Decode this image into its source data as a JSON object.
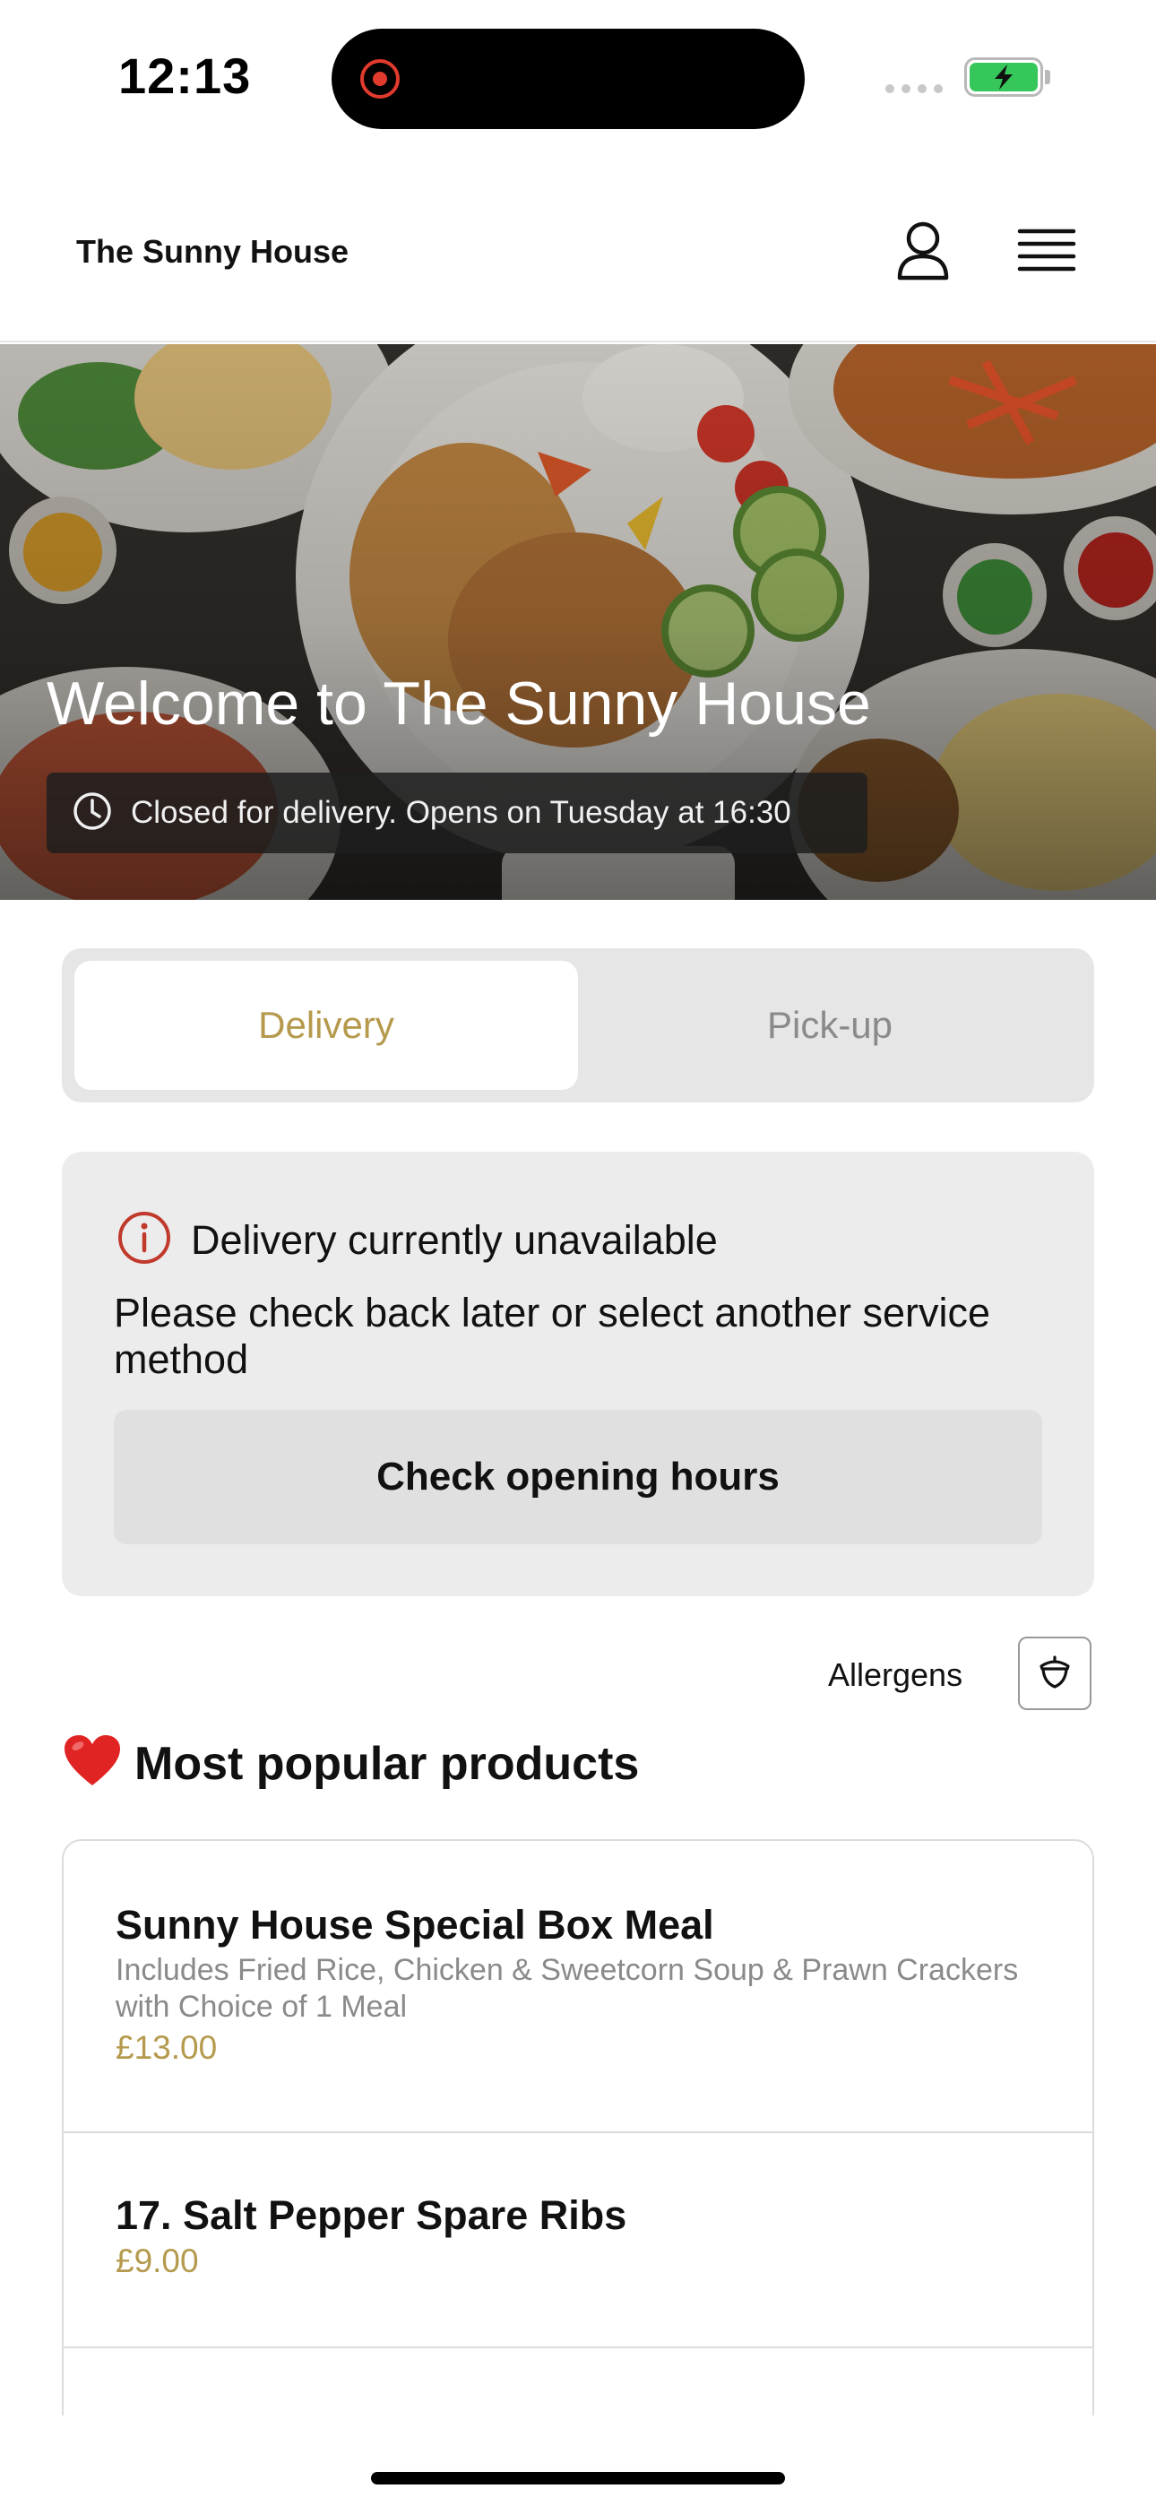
{
  "status_bar": {
    "time": "12:13"
  },
  "header": {
    "brand": "The Sunny House",
    "icons": [
      "user-icon",
      "menu-icon"
    ]
  },
  "hero": {
    "title": "Welcome to The Sunny House",
    "status": "Closed for delivery. Opens on Tuesday at 16:30"
  },
  "service_tabs": {
    "items": [
      {
        "label": "Delivery",
        "selected": true
      },
      {
        "label": "Pick-up",
        "selected": false
      }
    ]
  },
  "alert": {
    "title": "Delivery currently unavailable",
    "body": "Please check back later or select another service method",
    "button": "Check opening hours"
  },
  "allergens": {
    "label": "Allergens"
  },
  "popular": {
    "emoji": "❤️",
    "title": "Most popular products",
    "products": [
      {
        "name": "Sunny House Special Box Meal",
        "description": "Includes Fried Rice, Chicken & Sweetcorn Soup & Prawn Crackers with Choice of 1 Meal",
        "price": "£13.00"
      },
      {
        "name": "17. Salt Pepper Spare Ribs",
        "price": "£9.00"
      }
    ]
  },
  "colors": {
    "accent": "#b59a4d",
    "alert_icon": "#c0392b",
    "battery": "#35c759"
  }
}
